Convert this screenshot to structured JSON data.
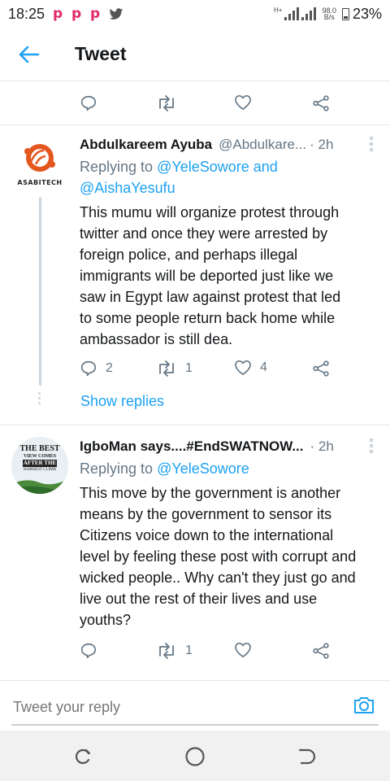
{
  "status_bar": {
    "time": "18:25",
    "app_icons": [
      "p",
      "p",
      "p"
    ],
    "network_type": "H+",
    "speed_value": "98.0",
    "speed_unit": "B/s",
    "battery": "23%"
  },
  "header": {
    "title": "Tweet"
  },
  "tweets": [
    {
      "name": "Abdulkareem Ayuba",
      "handle": "@Abdulkare...",
      "time": "· 2h",
      "avatar_caption": "ASABITECH",
      "replying_prefix": "Replying to",
      "replying_to": "@YeleSowore and @AishaYesufu",
      "replying_line1": "@YeleSowore and",
      "replying_line2": "@AishaYesufu",
      "body_lines": [
        "This mumu  will organize  protest through",
        "twitter and once they were arrested  by",
        "foreign  police, and perhaps  illegal",
        "immigrants will be deported just like we",
        "saw in Egypt  law against  protest  that led",
        "to some people  return  back home while",
        "ambassador  is still dea."
      ],
      "reply_count": "2",
      "retweet_count": "1",
      "like_count": "4",
      "show_replies": "Show replies"
    },
    {
      "name": "IgboMan says....#EndSWATNOW...",
      "time": "· 2h",
      "avatar_lines": [
        "THE BEST",
        "VIEW COMES",
        "AFTER THE",
        "HARDEST CLIMB"
      ],
      "replying_prefix": "Replying to",
      "replying_to": "@YeleSowore",
      "body_lines": [
        "This move by the government is another",
        "means by the government to sensor its",
        "Citizens voice down to the international",
        "level by feeling these post with corrupt and",
        "wicked people.. Why can't they just go and",
        "live out the rest of their lives and use",
        "youths?"
      ],
      "retweet_count": "1"
    }
  ],
  "composer": {
    "placeholder": "Tweet your reply"
  },
  "colors": {
    "accent": "#1da1f2",
    "secondary_text": "#657786",
    "divider": "#e1e8ed"
  },
  "icons": [
    "back-arrow-icon",
    "reply-icon",
    "retweet-icon",
    "like-icon",
    "share-icon",
    "more-icon",
    "camera-icon"
  ]
}
